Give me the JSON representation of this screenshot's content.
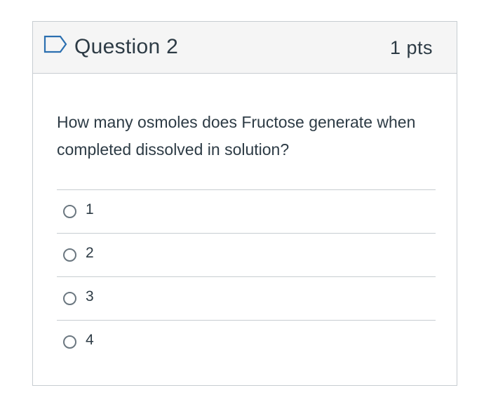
{
  "question": {
    "title": "Question 2",
    "points": "1 pts",
    "text": "How many osmoles does Fructose generate when completed dissolved in solution?",
    "flag_icon": "flag-icon"
  },
  "answers": [
    {
      "label": "1",
      "selected": false
    },
    {
      "label": "2",
      "selected": false
    },
    {
      "label": "3",
      "selected": false
    },
    {
      "label": "4",
      "selected": false
    }
  ],
  "colors": {
    "header_bg": "#f5f5f5",
    "border": "#c7cdd1",
    "text": "#2d3b45",
    "flag_accent": "#2b6fb0"
  }
}
